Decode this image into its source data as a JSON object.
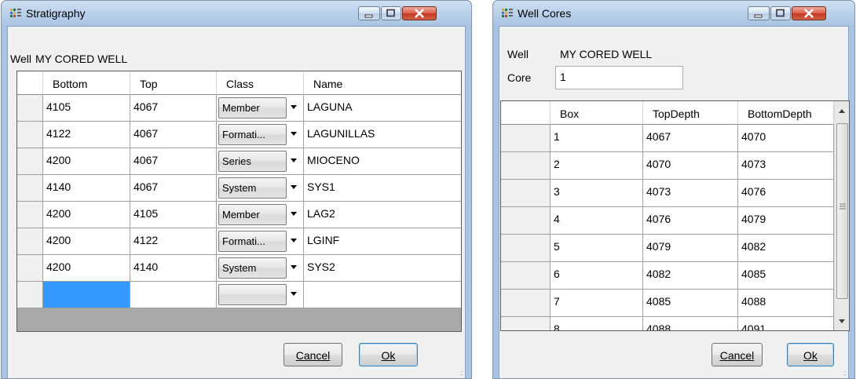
{
  "strat": {
    "title": "Stratigraphy",
    "well_label": "Well",
    "well_value": "MY CORED WELL",
    "columns": [
      "Bottom",
      "Top",
      "Class",
      "Name"
    ],
    "rows": [
      {
        "bottom": "4105",
        "top": "4067",
        "cls": "Member",
        "name": "LAGUNA"
      },
      {
        "bottom": "4122",
        "top": "4067",
        "cls": "Formati...",
        "name": "LAGUNILLAS"
      },
      {
        "bottom": "4200",
        "top": "4067",
        "cls": "Series",
        "name": "MIOCENO"
      },
      {
        "bottom": "4140",
        "top": "4067",
        "cls": "System",
        "name": "SYS1"
      },
      {
        "bottom": "4200",
        "top": "4105",
        "cls": "Member",
        "name": "LAG2"
      },
      {
        "bottom": "4200",
        "top": "4122",
        "cls": "Formati...",
        "name": "LGINF"
      },
      {
        "bottom": "4200",
        "top": "4140",
        "cls": "System",
        "name": "SYS2"
      }
    ],
    "cancel_label": "Cancel",
    "ok_label": "Ok",
    "selected_cell_color": "#3399ff"
  },
  "cores": {
    "title": "Well Cores",
    "well_label": "Well",
    "well_value": "MY CORED WELL",
    "core_label": "Core",
    "core_value": "1",
    "columns": [
      "Box",
      "TopDepth",
      "BottomDepth"
    ],
    "rows": [
      {
        "box": "1",
        "top": "4067",
        "bottom": "4070"
      },
      {
        "box": "2",
        "top": "4070",
        "bottom": "4073"
      },
      {
        "box": "3",
        "top": "4073",
        "bottom": "4076"
      },
      {
        "box": "4",
        "top": "4076",
        "bottom": "4079"
      },
      {
        "box": "5",
        "top": "4079",
        "bottom": "4082"
      },
      {
        "box": "6",
        "top": "4082",
        "bottom": "4085"
      },
      {
        "box": "7",
        "top": "4085",
        "bottom": "4088"
      },
      {
        "box": "8",
        "top": "4088",
        "bottom": "4091"
      }
    ],
    "cancel_label": "Cancel",
    "ok_label": "Ok"
  },
  "icons": {
    "app_icon": "app-icon",
    "minimize": "minimize-icon",
    "maximize": "maximize-icon",
    "close": "close-icon",
    "dropdown": "chevron-down-icon",
    "scroll_up": "scroll-up-icon",
    "scroll_down": "scroll-down-icon"
  },
  "colors": {
    "title_gradient": "#bcd3ec",
    "close_button": "#c5381e",
    "client_bg": "#f0f0f0",
    "grid_empty": "#a9a9a9"
  }
}
